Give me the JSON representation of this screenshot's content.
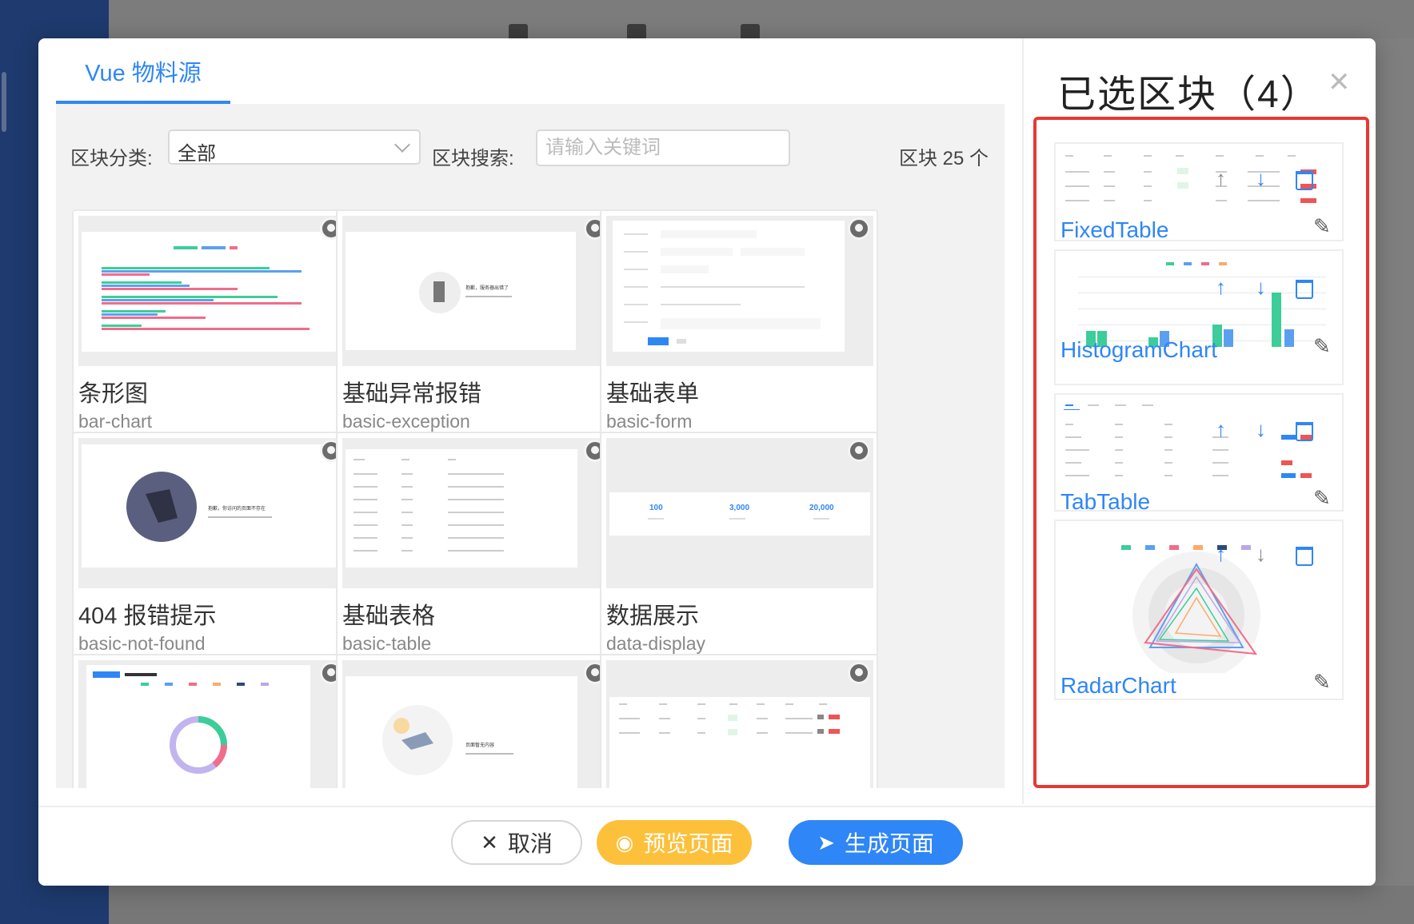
{
  "modal": {
    "tab_label": "Vue 物料源",
    "filter": {
      "category_label": "区块分类:",
      "category_value": "全部",
      "search_label": "区块搜索:",
      "search_placeholder": "请输入关键词",
      "count_text": "区块 25 个"
    },
    "blocks": [
      {
        "title": "条形图",
        "name": "bar-chart"
      },
      {
        "title": "基础异常报错",
        "name": "basic-exception"
      },
      {
        "title": "基础表单",
        "name": "basic-form"
      },
      {
        "title": "404 报错提示",
        "name": "basic-not-found"
      },
      {
        "title": "基础表格",
        "name": "basic-table"
      },
      {
        "title": "数据展示",
        "name": "data-display"
      }
    ],
    "thumb_text": {
      "exception": "抱歉，服务器出错了",
      "not_found": "抱歉，你访问的页面不存在",
      "empty_page": "页面暂无内容",
      "data_values": [
        "100",
        "3,000",
        "20,000"
      ]
    },
    "footer": {
      "cancel": "取消",
      "preview": "预览页面",
      "generate": "生成页面"
    },
    "selected": {
      "title": "已选区块（4）",
      "items": [
        {
          "name": "FixedTable"
        },
        {
          "name": "HistogramChart"
        },
        {
          "name": "TabTable"
        },
        {
          "name": "RadarChart"
        }
      ]
    }
  },
  "colors": {
    "primary": "#2f86f6",
    "warning": "#fdc03a",
    "highlight_border": "#e53935",
    "sidebar": "#1e3a6e"
  },
  "icons": [
    "github-icon",
    "chevron-down-icon",
    "close-icon",
    "eye-icon",
    "send-icon",
    "arrow-up-icon",
    "arrow-down-icon",
    "trash-icon",
    "edit-icon"
  ]
}
